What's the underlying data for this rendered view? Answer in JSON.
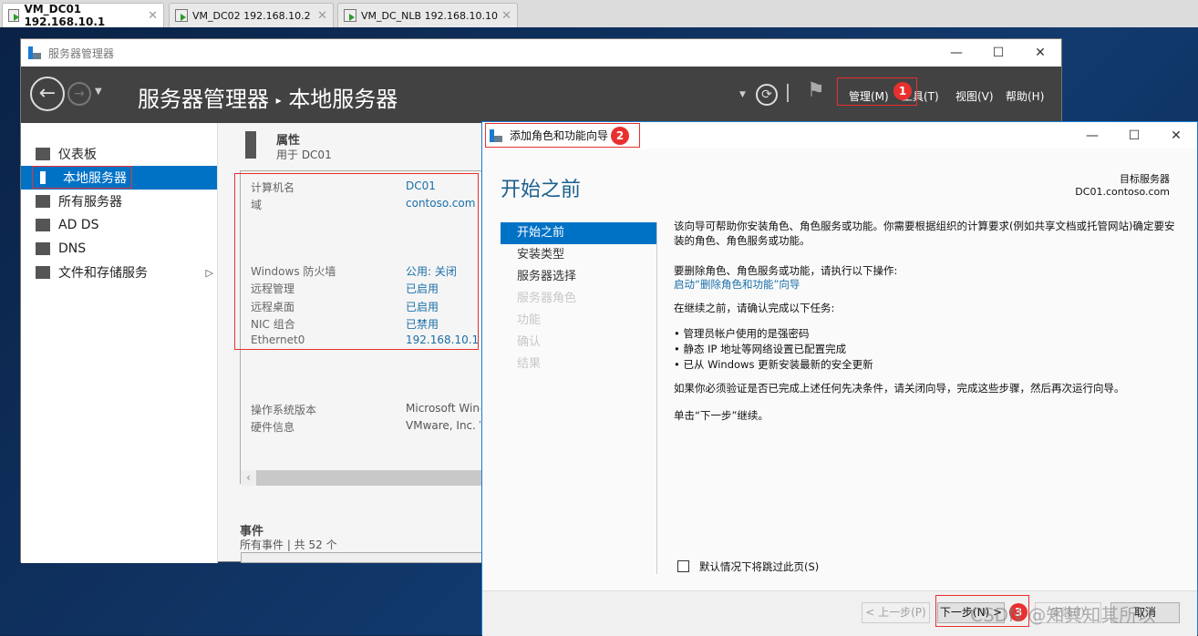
{
  "vm_tabs": [
    {
      "label": "VM_DC01 192.168.10.1",
      "active": true
    },
    {
      "label": "VM_DC02 192.168.10.2",
      "active": false
    },
    {
      "label": "VM_DC_NLB 192.168.10.10",
      "active": false
    }
  ],
  "server_manager": {
    "window_title": "服务器管理器",
    "breadcrumb": {
      "root": "服务器管理器",
      "separator": "▸",
      "current": "本地服务器"
    },
    "menu": [
      "管理(M)",
      "工具(T)",
      "视图(V)",
      "帮助(H)"
    ],
    "sidebar": [
      {
        "label": "仪表板"
      },
      {
        "label": "本地服务器",
        "selected": true
      },
      {
        "label": "所有服务器"
      },
      {
        "label": "AD DS"
      },
      {
        "label": "DNS"
      },
      {
        "label": "文件和存储服务",
        "arrow": "▷"
      }
    ],
    "properties": {
      "title": "属性",
      "subtitle": "用于 DC01",
      "rows": [
        {
          "label": "计算机名",
          "value": "DC01"
        },
        {
          "label": "域",
          "value": "contoso.com"
        },
        {
          "label": "Windows 防火墙",
          "value": "公用: 关闭"
        },
        {
          "label": "远程管理",
          "value": "已启用"
        },
        {
          "label": "远程桌面",
          "value": "已启用"
        },
        {
          "label": "NIC 组合",
          "value": "已禁用"
        },
        {
          "label": "Ethernet0",
          "value": "192.168.10.1"
        },
        {
          "label": "操作系统版本",
          "value": "Microsoft Wind"
        },
        {
          "label": "硬件信息",
          "value": "VMware, Inc. V"
        }
      ]
    },
    "events": {
      "title": "事件",
      "subtitle": "所有事件 | 共 52 个"
    }
  },
  "wizard": {
    "title": "添加角色和功能向导",
    "heading": "开始之前",
    "target_label": "目标服务器",
    "target_value": "DC01.contoso.com",
    "steps": [
      {
        "label": "开始之前",
        "state": "selected"
      },
      {
        "label": "安装类型",
        "state": "enabled"
      },
      {
        "label": "服务器选择",
        "state": "enabled"
      },
      {
        "label": "服务器角色",
        "state": "disabled"
      },
      {
        "label": "功能",
        "state": "disabled"
      },
      {
        "label": "确认",
        "state": "disabled"
      },
      {
        "label": "结果",
        "state": "disabled"
      }
    ],
    "intro": "该向导可帮助你安装角色、角色服务或功能。你需要根据组织的计算要求(例如共享文档或托管网站)确定要安装的角色、角色服务或功能。",
    "remove_text": "要删除角色、角色服务或功能，请执行以下操作:",
    "remove_link": "启动“删除角色和功能”向导",
    "confirm_text": "在继续之前，请确认完成以下任务:",
    "bullets": [
      "管理员帐户使用的是强密码",
      "静态 IP 地址等网络设置已配置完成",
      "已从 Windows 更新安装最新的安全更新"
    ],
    "verify_text": "如果你必须验证是否已完成上述任何先决条件，请关闭向导，完成这些步骤，然后再次运行向导。",
    "continue_text": "单击“下一步”继续。",
    "skip_checkbox": "默认情况下将跳过此页(S)",
    "buttons": {
      "prev": "< 上一步(P)",
      "next": "下一步(N) >",
      "install": "安装(I)",
      "cancel": "取消"
    }
  },
  "annotations": [
    "1",
    "2",
    "3"
  ],
  "watermark": "CSDN @知其知其所以"
}
